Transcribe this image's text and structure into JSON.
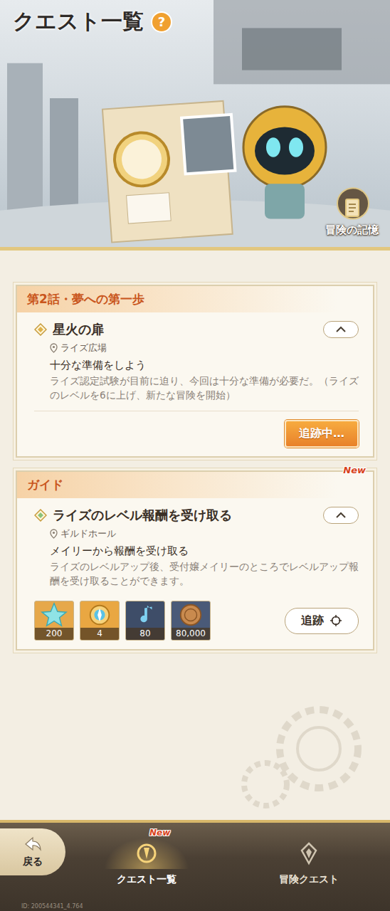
{
  "header": {
    "title": "クエスト一覧",
    "help": "?",
    "memory_button": "冒険の記憶"
  },
  "quests": [
    {
      "category": "第2話・夢への第一歩",
      "badge": null,
      "title": "星火の扉",
      "location": "ライズ広場",
      "objective": "十分な準備をしよう",
      "description": "ライズ認定試験が目前に迫り、今回は十分な準備が必要だ。（ライズのレベルを6に上げ、新たな冒険を開始）",
      "expanded": true,
      "rewards": [],
      "track_button": {
        "label": "追跡中…",
        "tracking": true
      }
    },
    {
      "category": "ガイド",
      "badge": "New",
      "title": "ライズのレベル報酬を受け取る",
      "location": "ギルドホール",
      "objective": "メイリーから報酬を受け取る",
      "description": "ライズのレベルアップ後、受付嬢メイリーのところでレベルアップ報酬を受け取ることができます。",
      "expanded": true,
      "rewards": [
        {
          "kind": "crystal",
          "count": "200"
        },
        {
          "kind": "compass",
          "count": "4"
        },
        {
          "kind": "note",
          "count": "80"
        },
        {
          "kind": "coin",
          "count": "80,000"
        }
      ],
      "track_button": {
        "label": "追跡",
        "tracking": false
      }
    }
  ],
  "nav": {
    "back": "戻る",
    "tabs": [
      {
        "label": "クエスト一覧",
        "selected": true,
        "badge": "New",
        "kind": "quest"
      },
      {
        "label": "冒険クエスト",
        "selected": false,
        "badge": null,
        "kind": "adventure"
      }
    ]
  },
  "footer_id": "ID: 200544341_4.764"
}
